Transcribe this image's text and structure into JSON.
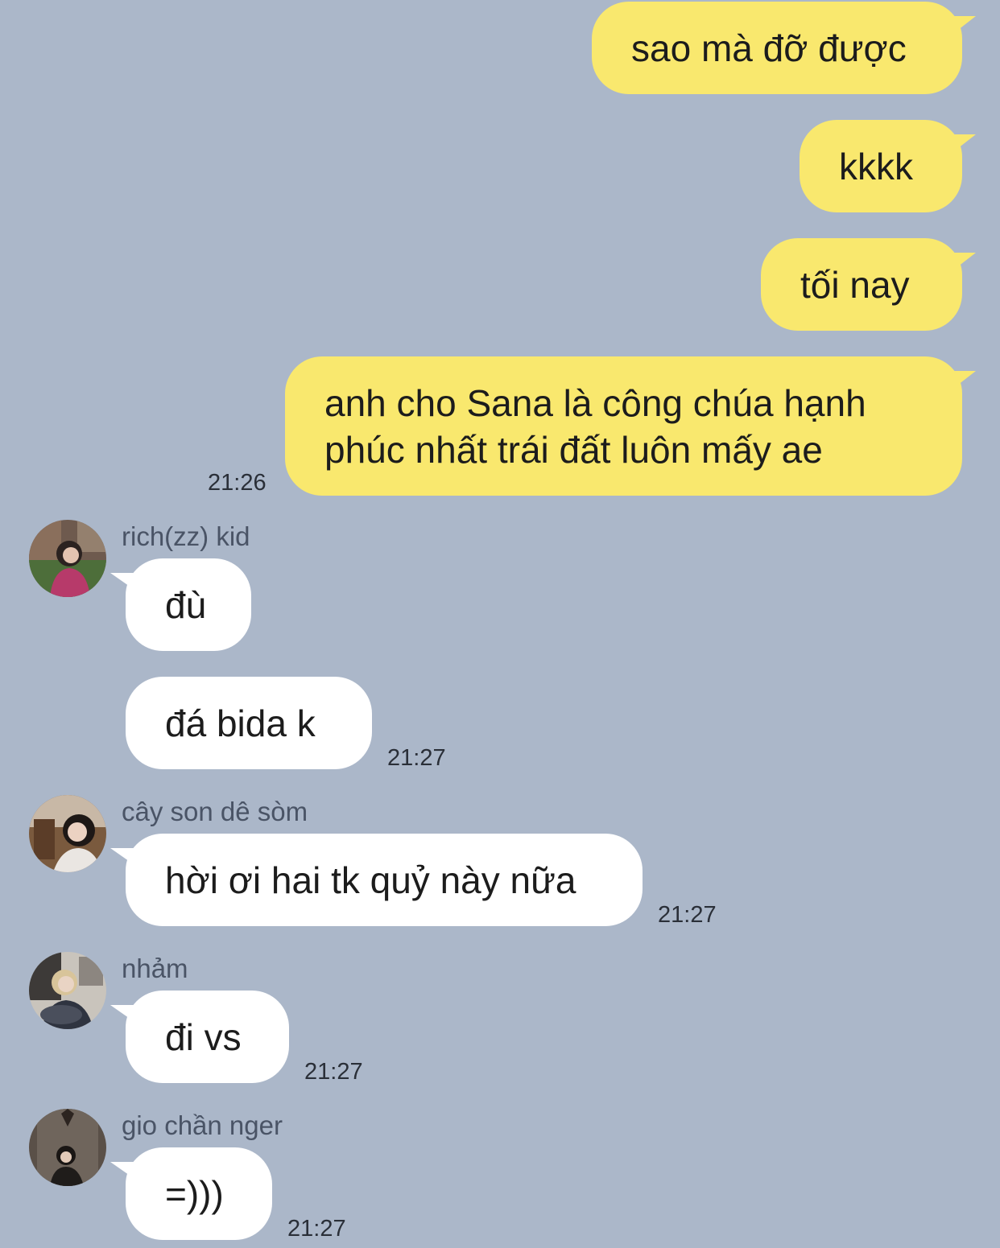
{
  "chat": {
    "outgoing": [
      {
        "text": "sao mà đỡ được"
      },
      {
        "text": "kkkk"
      },
      {
        "text": "tối nay"
      },
      {
        "lines": [
          "anh cho Sana là công chúa hạnh",
          "phúc nhất trái đất luôn mấy ae"
        ],
        "time": "21:26"
      }
    ],
    "incoming": [
      {
        "sender": "rich(zz) kid",
        "avatar_icon": "profile-photo-icon",
        "messages": [
          {
            "text": "đù"
          },
          {
            "text": "đá bida k",
            "time": "21:27"
          }
        ]
      },
      {
        "sender": "cây son dê sòm",
        "avatar_icon": "profile-photo-icon",
        "messages": [
          {
            "text": "hời ơi hai tk quỷ này nữa",
            "time": "21:27"
          }
        ]
      },
      {
        "sender": "nhảm",
        "avatar_icon": "profile-photo-icon",
        "messages": [
          {
            "text": "đi vs",
            "time": "21:27"
          }
        ]
      },
      {
        "sender": "gio chần nger",
        "avatar_icon": "profile-photo-icon",
        "messages": [
          {
            "text": "=)))",
            "time": "21:27"
          }
        ]
      }
    ]
  },
  "colors": {
    "background": "#abb7c9",
    "outgoing_bubble": "#f9e86e",
    "incoming_bubble": "#ffffff",
    "text": "#1c1c1c",
    "sender_name": "#4a5466"
  }
}
